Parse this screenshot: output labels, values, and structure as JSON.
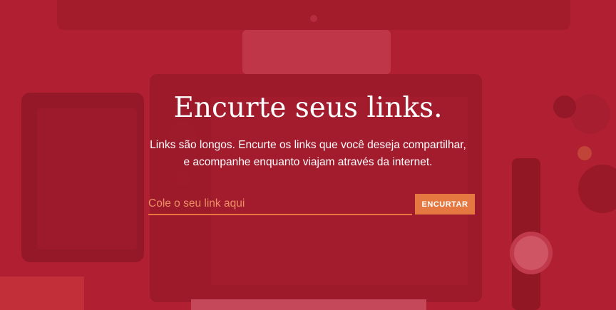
{
  "hero": {
    "title": "Encurte seus links.",
    "subtitle_line1": "Links são longos. Encurte os links que você deseja compartilhar,",
    "subtitle_line2": "e acompanhe enquanto viajam através da internet."
  },
  "form": {
    "input_placeholder": "Cole o seu link aqui",
    "input_value": "",
    "button_label": "ENCURTAR"
  },
  "colors": {
    "overlay": "#b1273a",
    "accent": "#e57840",
    "text": "#ffffff"
  }
}
